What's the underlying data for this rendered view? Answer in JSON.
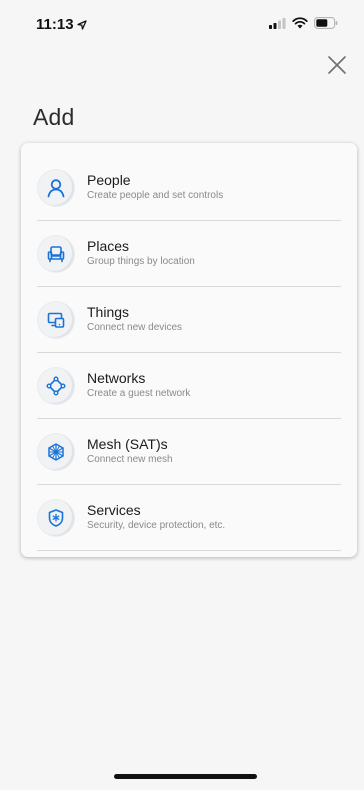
{
  "status_bar": {
    "time": "11:13"
  },
  "page": {
    "title": "Add",
    "close_icon": "close-icon"
  },
  "items": [
    {
      "title": "People",
      "subtitle": "Create people and set controls",
      "icon": "person-icon"
    },
    {
      "title": "Places",
      "subtitle": "Group things by location",
      "icon": "sofa-icon"
    },
    {
      "title": "Things",
      "subtitle": "Connect new devices",
      "icon": "devices-icon"
    },
    {
      "title": "Networks",
      "subtitle": "Create a guest network",
      "icon": "network-icon"
    },
    {
      "title": "Mesh (SAT)s",
      "subtitle": "Connect new mesh",
      "icon": "mesh-icon"
    },
    {
      "title": "Services",
      "subtitle": "Security, device protection, etc.",
      "icon": "shield-icon"
    }
  ],
  "colors": {
    "accent": "#1a73d9",
    "background": "#f6f6f6"
  }
}
